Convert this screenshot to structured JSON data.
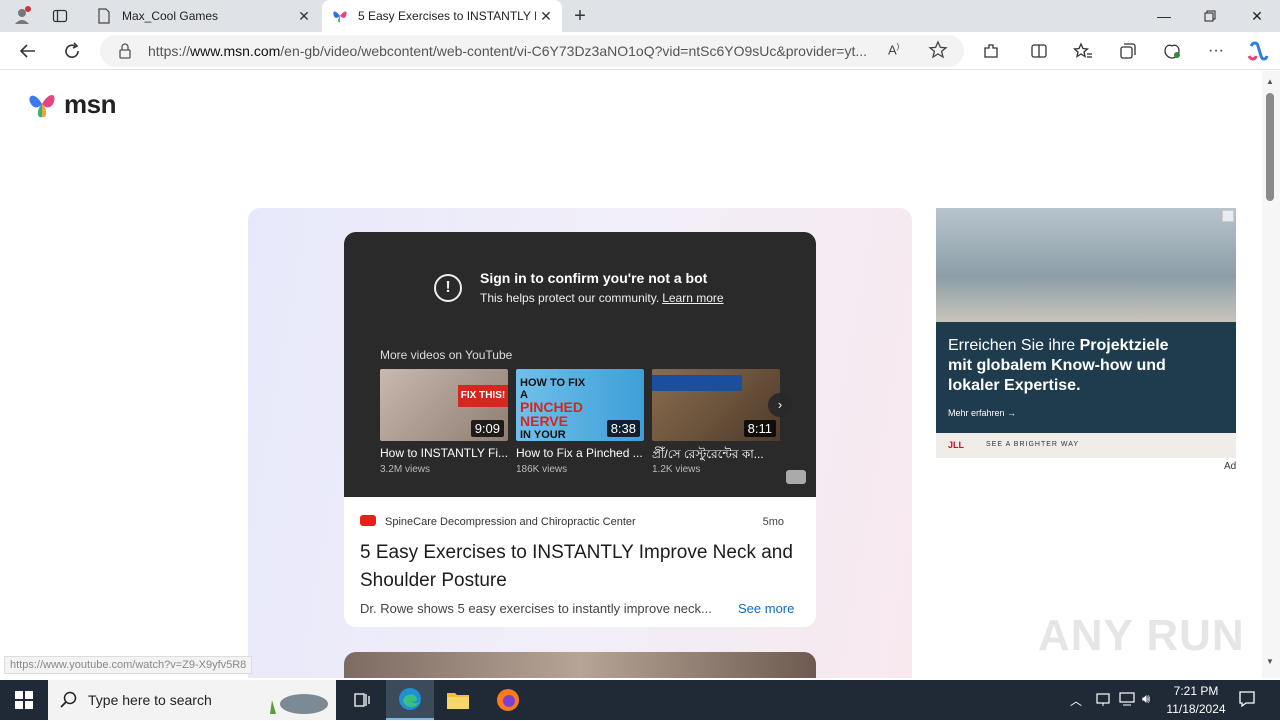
{
  "browser": {
    "tabs": [
      {
        "label": "Max_Cool Games",
        "icon": "page-icon"
      },
      {
        "label": "5 Easy Exercises to INSTANTLY Im",
        "icon": "msn-butterfly-icon",
        "active": true
      }
    ],
    "url_prefix": "https://",
    "url_domain": "www.msn.com",
    "url_rest": "/en-gb/video/webcontent/web-content/vi-C6Y73Dz3aNO1oQ?vid=ntSc6YO9sUc&provider=yt..."
  },
  "page": {
    "logo_text": "msn",
    "player": {
      "bot_title": "Sign in to confirm you're not a bot",
      "bot_sub": "This helps protect our community.",
      "learn_more": "Learn more",
      "more_videos": "More videos on YouTube",
      "videos": [
        {
          "title": "How to INSTANTLY Fi...",
          "views": "3.2M views",
          "duration": "9:09"
        },
        {
          "title": "How to Fix a Pinched ...",
          "views": "186K views",
          "duration": "8:38"
        },
        {
          "title": "প্রীঁ/সে রেস্টুরেন্টের কা...",
          "views": "1.2K views",
          "duration": "8:11"
        }
      ]
    },
    "info": {
      "channel": "SpineCare Decompression and Chiropractic Center",
      "age": "5mo",
      "headline": "5 Easy Exercises to INSTANTLY Improve Neck and Shoulder Posture",
      "description": "Dr. Rowe shows 5 easy exercises to instantly improve neck...",
      "see_more": "See more"
    },
    "ad": {
      "text_pre": "Erreichen Sie ihre ",
      "text_bold": "Projektziele mit globalem Know-how und lokaler Expertise.",
      "link": "Mehr erfahren →",
      "brand": "JLL",
      "tagline": "SEE A BRIGHTER WAY",
      "label": "Ad"
    },
    "status_url": "https://www.youtube.com/watch?v=Z9-X9yfv5R8",
    "watermark": "ANY RUN"
  },
  "taskbar": {
    "search_placeholder": "Type here to search",
    "time": "7:21 PM",
    "date": "11/18/2024"
  }
}
